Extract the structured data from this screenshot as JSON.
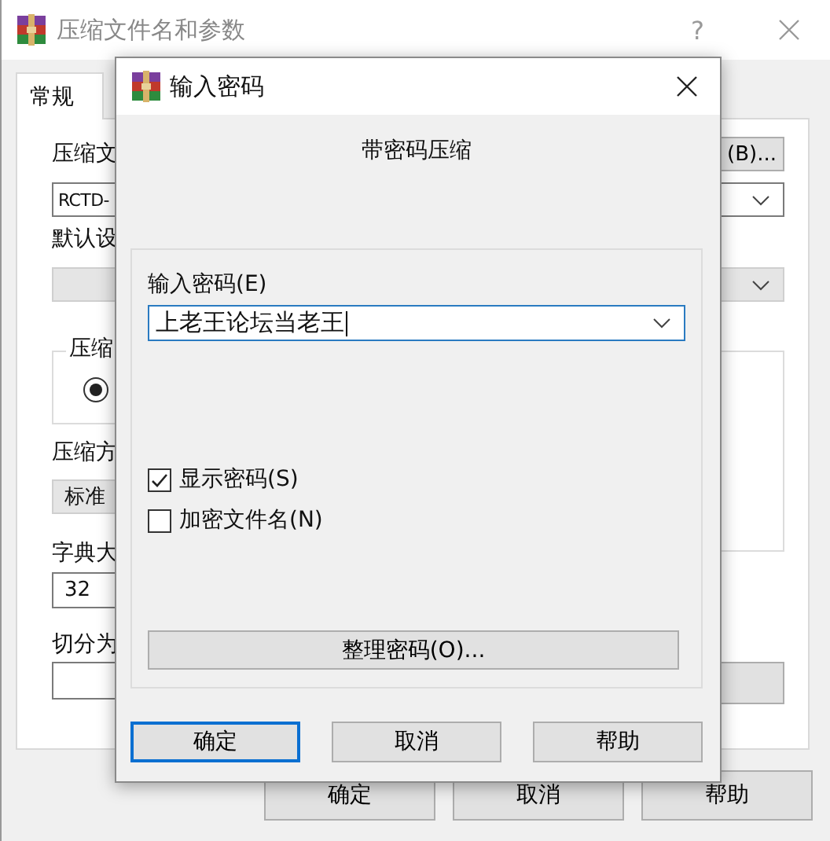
{
  "window": {
    "title": "压缩文件名和参数",
    "help": "?"
  },
  "tabs": [
    {
      "label": "常规",
      "selected": true
    }
  ],
  "form": {
    "archive_label": "压缩文",
    "browse_button": "(B)...",
    "archive_name": "RCTD-",
    "profile_label": "默认设",
    "group_label": "压缩",
    "radio_selected": true,
    "method_label": "压缩方",
    "method_value": "标准",
    "dict_label": "字典大",
    "dict_value": "32",
    "split_label": "切分为"
  },
  "buttons": [
    {
      "label": "确定"
    },
    {
      "label": "取消"
    },
    {
      "label": "帮助"
    }
  ],
  "dialog": {
    "title": "输入密码",
    "heading": "带密码压缩",
    "password_label": "输入密码(E)",
    "password": "上老王论坛当老王",
    "options": [
      {
        "label": "显示密码(S)",
        "checked": true
      },
      {
        "label": "加密文件名(N)",
        "checked": false
      }
    ],
    "organize_button": "整理密码(O)...",
    "buttons": [
      {
        "label": "确定",
        "default": true
      },
      {
        "label": "取消",
        "default": false
      },
      {
        "label": "帮助",
        "default": false
      }
    ]
  }
}
